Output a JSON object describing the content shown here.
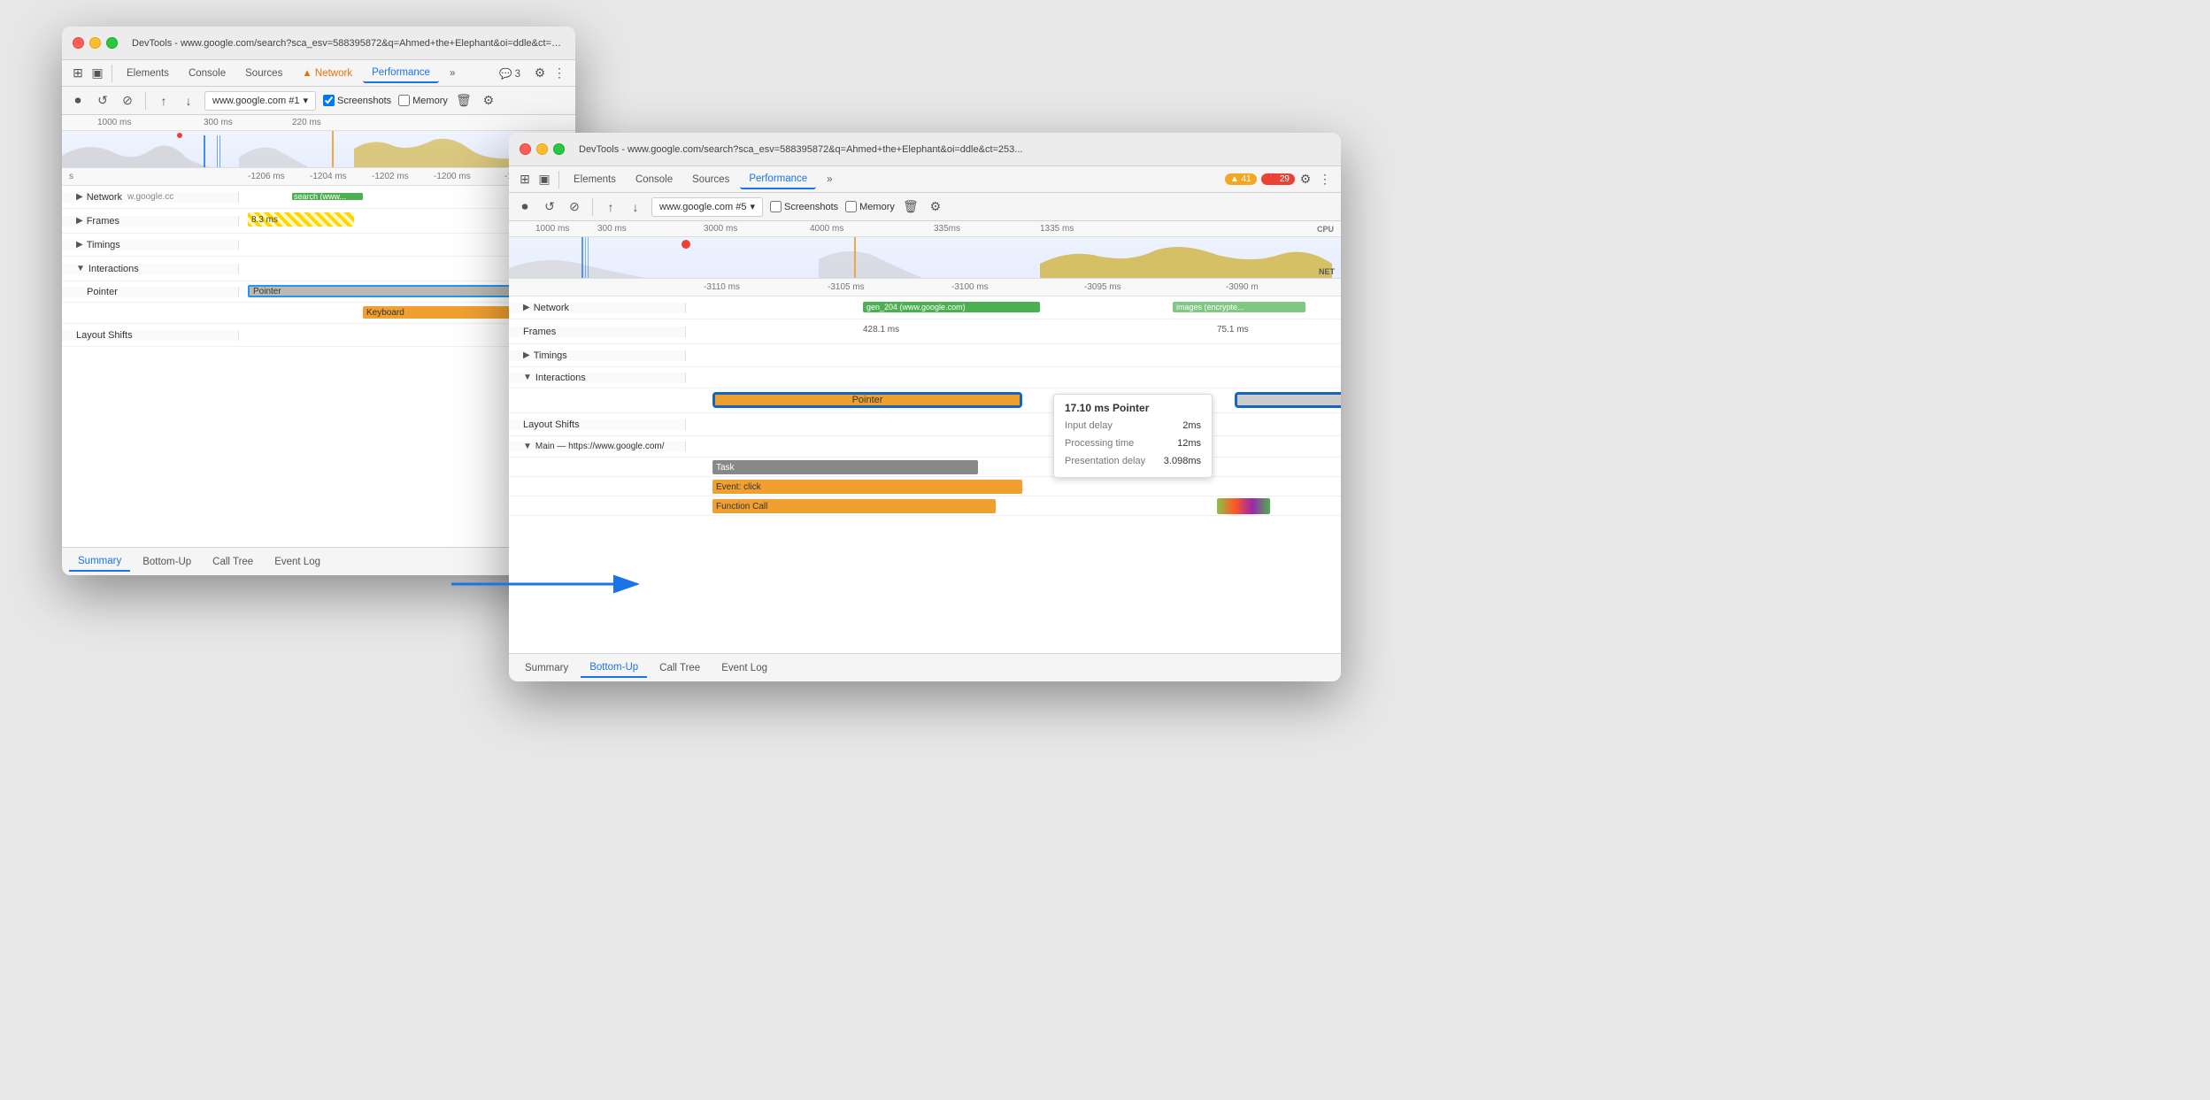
{
  "window1": {
    "title": "DevTools - www.google.com/search?sca_esv=588395872&q=Ahmed+the+Elephant&oi=ddle&ct=25...",
    "tabs": [
      "Elements",
      "Console",
      "Sources",
      "Network",
      "Performance",
      "»"
    ],
    "badges": {
      "warning": "▲",
      "chat": "💬 3"
    },
    "active_tab": "Performance",
    "url": "www.google.com #1",
    "checkboxes": [
      "Screenshots",
      "Memory"
    ],
    "timeline_ticks": [
      "-1206 ms",
      "-1204 ms",
      "-1202 ms",
      "-1200 ms",
      "-1198 m"
    ],
    "tracks": {
      "network_label": "Network",
      "network_value": "w.google.cc",
      "frames_label": "Frames",
      "frames_value": "8.3 ms",
      "timings_label": "Timings",
      "interactions_label": "Interactions",
      "pointer_label": "Pointer",
      "keyboard_label": "Keyboard",
      "layout_shifts_label": "Layout Shifts",
      "search_tooltip": "search (www..."
    },
    "bottom_tabs": [
      "Summary",
      "Bottom-Up",
      "Call Tree",
      "Event Log"
    ],
    "active_bottom_tab": "Summary"
  },
  "window2": {
    "title": "DevTools - www.google.com/search?sca_esv=588395872&q=Ahmed+the+Elephant&oi=ddle&ct=253...",
    "tabs": [
      "Elements",
      "Console",
      "Sources",
      "Performance",
      "»"
    ],
    "badge_warning": "▲ 41",
    "badge_error": "❗ 29",
    "active_tab": "Performance",
    "url": "www.google.com #5",
    "checkboxes": [
      "Screenshots",
      "Memory"
    ],
    "timeline_ticks": [
      "1000 ms",
      "300 ms",
      "3000 ms",
      "4000 ms",
      "335ms",
      "1335 ms"
    ],
    "ruler_ticks": [
      "-3110 ms",
      "-3105 ms",
      "-3100 ms",
      "-3095 ms",
      "-3090 m"
    ],
    "cpu_label": "CPU",
    "net_label": "NET",
    "tracks": {
      "network_label": "Network",
      "frames_label": "Frames",
      "frames_value": "428.1 ms",
      "frames_value2": "75.1 ms",
      "gen_204": "gen_204 (www.google.com)",
      "images": "images (encrypte...",
      "timings_label": "Timings",
      "interactions_label": "Interactions",
      "pointer_label": "Pointer",
      "layout_shifts_label": "Layout Shifts",
      "main_label": "Main — https://www.google.com/",
      "task_label": "Task",
      "event_click": "Event: click",
      "function_call": "Function Call"
    },
    "tooltip": {
      "title": "17.10 ms  Pointer",
      "input_delay_label": "Input delay",
      "input_delay_value": "2ms",
      "processing_time_label": "Processing time",
      "processing_time_value": "12ms",
      "presentation_delay_label": "Presentation delay",
      "presentation_delay_value": "3.098ms"
    },
    "bottom_tabs": [
      "Summary",
      "Bottom-Up",
      "Call Tree",
      "Event Log"
    ],
    "active_bottom_tab": "Bottom-Up"
  },
  "icons": {
    "record": "⏺",
    "refresh": "↺",
    "clear": "⊘",
    "upload": "↑",
    "download": "↓",
    "settings": "⚙",
    "more": "⋮",
    "selector": "⊞",
    "device": "▣",
    "chevron_right": "▶",
    "chevron_down": "▼",
    "trash": "🗑",
    "camera": "📷",
    "dropdown": "▾"
  },
  "colors": {
    "blue_active": "#1a73e8",
    "orange": "#f0a030",
    "yellow": "#ffd600",
    "gray_bar": "#bdb9b0",
    "blue_border": "#1565C0",
    "green": "#28c840"
  }
}
